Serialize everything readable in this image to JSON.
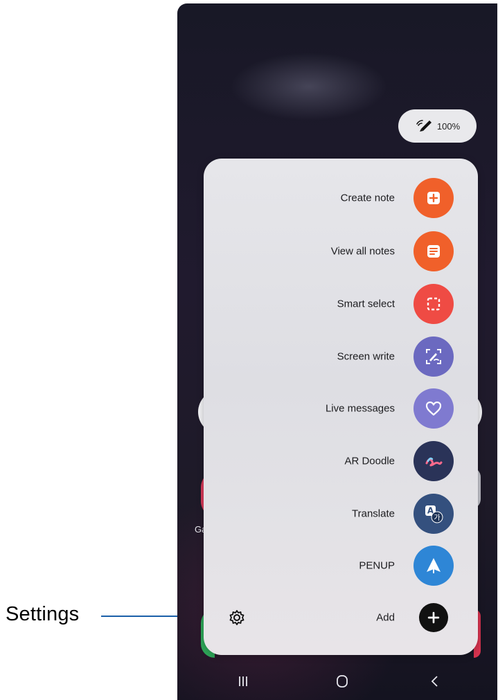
{
  "callout": {
    "label": "Settings",
    "color": "#1a5fa8"
  },
  "status": {
    "pen_battery": "100%",
    "pen_icon": "s-pen-icon"
  },
  "background": {
    "partial_label": "Ga"
  },
  "air_command": {
    "items": [
      {
        "label": "Create note",
        "icon": "create-note-icon",
        "color": "#f0602a"
      },
      {
        "label": "View all notes",
        "icon": "view-all-notes-icon",
        "color": "#f0602a"
      },
      {
        "label": "Smart select",
        "icon": "smart-select-icon",
        "color": "#ef4b44"
      },
      {
        "label": "Screen write",
        "icon": "screen-write-icon",
        "color": "#6b69c0"
      },
      {
        "label": "Live messages",
        "icon": "live-messages-icon",
        "color": "#7f7ad0"
      },
      {
        "label": "AR Doodle",
        "icon": "ar-doodle-icon",
        "color": "#2a3358"
      },
      {
        "label": "Translate",
        "icon": "translate-icon",
        "color": "#34507e"
      },
      {
        "label": "PENUP",
        "icon": "penup-icon",
        "color": "#2e86d6"
      }
    ],
    "add_label": "Add",
    "settings_icon": "gear-icon",
    "translate_glyph_a": "A",
    "translate_glyph_ko": "가"
  },
  "nav_bar": {
    "recents_icon": "recents-icon",
    "home_icon": "home-icon",
    "back_icon": "back-icon"
  }
}
